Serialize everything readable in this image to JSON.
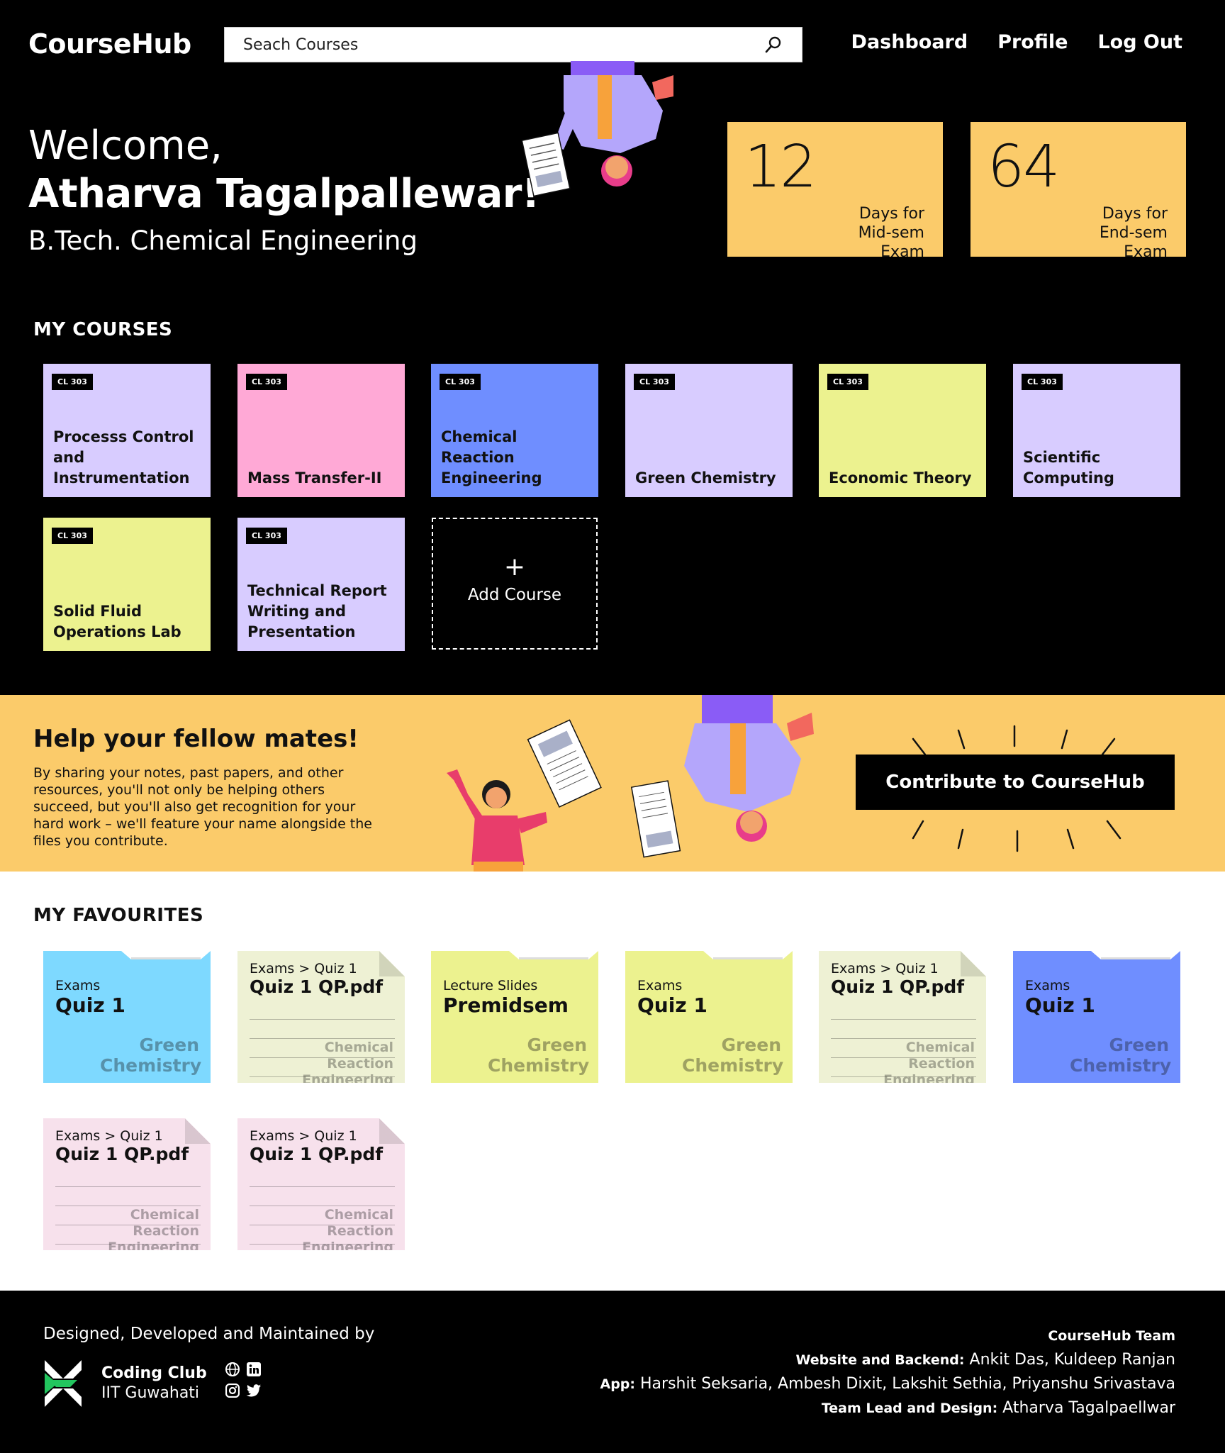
{
  "header": {
    "logo": "CourseHub",
    "search_placeholder": "Seach Courses",
    "nav": [
      "Dashboard",
      "Profile",
      "Log Out"
    ]
  },
  "hero": {
    "greeting": "Welcome,",
    "name": "Atharva Tagalpallewar!",
    "program": "B.Tech. Chemical Engineering",
    "countdowns": [
      {
        "number": "12",
        "label": "Days for Mid-sem Exam"
      },
      {
        "number": "64",
        "label": "Days for End-sem Exam"
      }
    ]
  },
  "courses": {
    "title": "MY COURSES",
    "items": [
      {
        "code": "CL 303",
        "name": "Processs Control and Instrumentation",
        "color": "#d8ccff"
      },
      {
        "code": "CL 303",
        "name": "Mass Transfer-II",
        "color": "#ffa9d6"
      },
      {
        "code": "CL 303",
        "name": "Chemical Reaction Engineering",
        "color": "#6f8eff"
      },
      {
        "code": "CL 303",
        "name": "Green Chemistry",
        "color": "#d8ccff"
      },
      {
        "code": "CL 303",
        "name": "Economic Theory",
        "color": "#ecf28f"
      },
      {
        "code": "CL 303",
        "name": "Scientific Computing",
        "color": "#d8ccff"
      },
      {
        "code": "CL 303",
        "name": "Solid Fluid Operations Lab",
        "color": "#ecf28f"
      },
      {
        "code": "CL 303",
        "name": "Technical Report Writing and Presentation",
        "color": "#d8ccff"
      }
    ],
    "add_plus": "+",
    "add_label": "Add Course"
  },
  "banner": {
    "title": "Help your fellow mates!",
    "text": "By sharing your notes, past papers, and other resources, you'll not only be helping others succeed, but you'll also get recognition for your hard work – we'll feature your name alongside the files you contribute.",
    "button": "Contribute to CourseHub"
  },
  "favourites": {
    "title": "MY FAVOURITES",
    "items": [
      {
        "kind": "folder",
        "crumb": "Exams",
        "title": "Quiz 1",
        "course": "Green Chemistry",
        "color": "#7ed9ff"
      },
      {
        "kind": "file",
        "crumb": "Exams > Quiz 1",
        "title": "Quiz 1 QP.pdf",
        "course": "Chemical Reaction Engineering",
        "color": "#eef1d4"
      },
      {
        "kind": "folder",
        "crumb": "Lecture Slides",
        "title": "Premidsem",
        "course": "Green Chemistry",
        "color": "#ecf28f"
      },
      {
        "kind": "folder",
        "crumb": "Exams",
        "title": "Quiz 1",
        "course": "Green Chemistry",
        "color": "#ecf28f"
      },
      {
        "kind": "file",
        "crumb": "Exams > Quiz 1",
        "title": "Quiz 1 QP.pdf",
        "course": "Chemical Reaction Engineering",
        "color": "#eef1d4"
      },
      {
        "kind": "folder",
        "crumb": "Exams",
        "title": "Quiz 1",
        "course": "Green Chemistry",
        "color": "#6f8eff"
      },
      {
        "kind": "file",
        "crumb": "Exams > Quiz 1",
        "title": "Quiz 1 QP.pdf",
        "course": "Chemical Reaction Engineering",
        "color": "#f7e1ec"
      },
      {
        "kind": "file",
        "crumb": "Exams > Quiz 1",
        "title": "Quiz 1 QP.pdf",
        "course": "Chemical Reaction Engineering",
        "color": "#f7e1ec"
      }
    ]
  },
  "footer": {
    "designed_by": "Designed, Developed and Maintained by",
    "club_name": "Coding Club",
    "club_inst": "IIT Guwahati",
    "team_title": "CourseHub Team",
    "credits": [
      {
        "role": "Website and Backend:",
        "names": "Ankit Das, Kuldeep Ranjan"
      },
      {
        "role": "App:",
        "names": "Harshit Seksaria, Ambesh Dixit, Lakshit Sethia, Priyanshu Srivastava"
      },
      {
        "role": "Team Lead and Design:",
        "names": "Atharva Tagalpaellwar"
      }
    ]
  }
}
